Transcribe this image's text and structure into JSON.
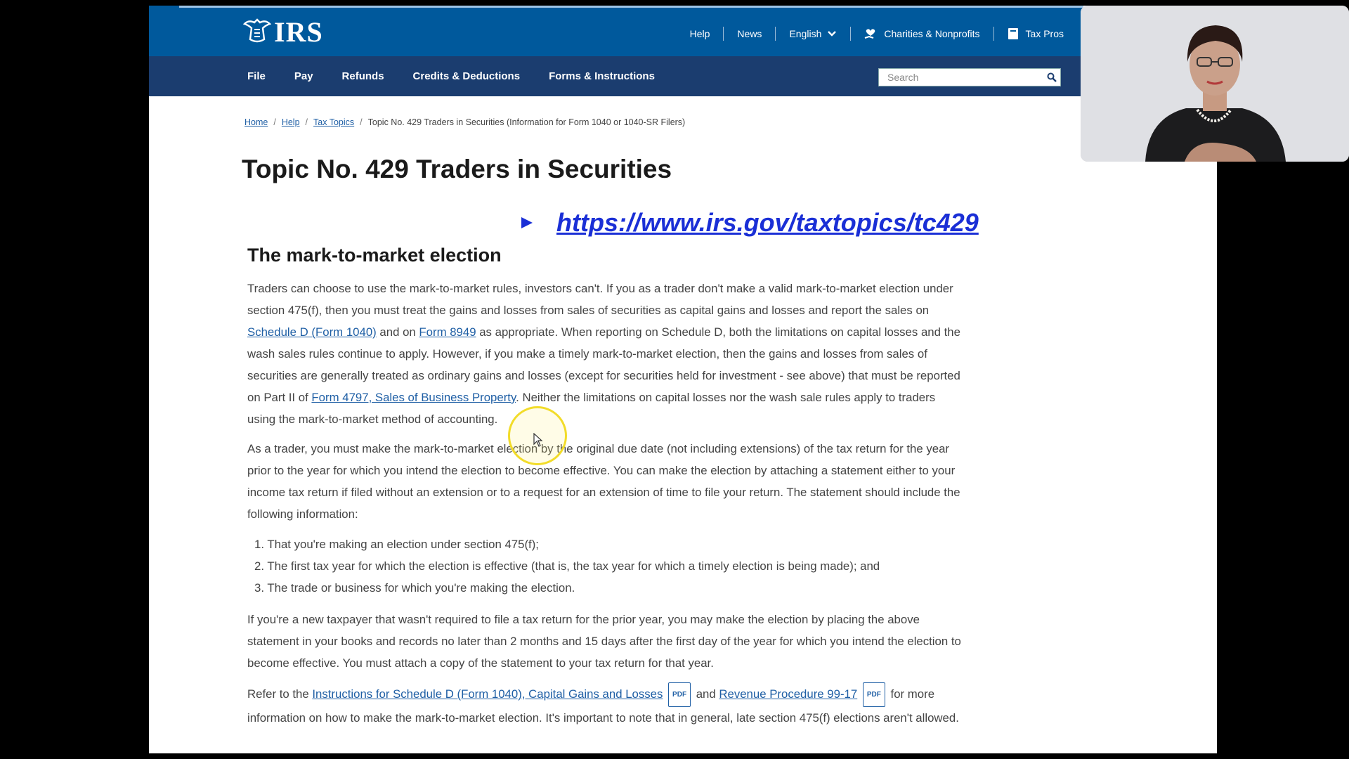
{
  "header": {
    "logo_text": "IRS",
    "top_links": [
      {
        "label": "Help"
      },
      {
        "label": "News"
      },
      {
        "label": "English"
      },
      {
        "label": "Charities & Nonprofits"
      },
      {
        "label": "Tax Pros"
      }
    ]
  },
  "nav": {
    "items": [
      "File",
      "Pay",
      "Refunds",
      "Credits & Deductions",
      "Forms & Instructions"
    ],
    "search_placeholder": "Search"
  },
  "breadcrumb": {
    "items": [
      "Home",
      "Help",
      "Tax Topics"
    ],
    "current": "Topic No. 429 Traders in Securities (Information for Form 1040 or 1040-SR Filers)"
  },
  "page": {
    "title": "Topic No. 429 Traders in Securities",
    "url": "https://www.irs.gov/taxtopics/tc429",
    "section_heading": "The mark-to-market election",
    "p1": {
      "a": "Traders can choose to use the mark-to-market rules, investors can't. If you as a trader don't make a valid mark-to-market election under section 475(f), then you must treat the gains and losses from sales of securities as capital gains and losses and report the sales on ",
      "link1": "Schedule D (Form 1040)",
      "b": " and on ",
      "link2": "Form 8949",
      "c": " as appropriate. When reporting on Schedule D, both the limitations on capital losses and the wash sales rules continue to apply. However, if you make a timely mark-to-market election, then the gains and losses from sales of securities are generally treated as ordinary gains and losses (except for securities held for investment - see above) that must be reported on Part II of ",
      "link3": "Form 4797, Sales of Business Property",
      "d": ". Neither the limitations on capital losses nor the wash sale rules apply to traders using the mark-to-market method of accounting."
    },
    "p2": "As a trader, you must make the mark-to-market election by the original due date (not including extensions) of the tax return for the year prior to the year for which you intend the election to become effective. You can make the election by attaching a statement either to your income tax return if filed without an extension or to a request for an extension of time to file your return. The statement should include the following information:",
    "steps": [
      "1. That you're making an election under section 475(f);",
      "2. The first tax year for which the election is effective (that is, the tax year for which a timely election is being made); and",
      "3. The trade or business for which you're making the election."
    ],
    "p3": "If you're a new taxpayer that wasn't required to file a tax return for the prior year, you may make the election by placing the above statement in your books and records no later than 2 months and 15 days after the first day of the year for which you intend the election to become effective. You must attach a copy of the statement to your tax return for that year.",
    "p4": {
      "a": "Refer to the ",
      "link1": "Instructions for Schedule D (Form 1040), Capital Gains and Losses",
      "pdf1": "PDF",
      "b": " and ",
      "link2": "Revenue Procedure 99-17",
      "pdf2": "PDF",
      "c": " for more information on how to make the mark-to-market election. It's important to note that in general, late section 475(f) elections aren't allowed."
    }
  },
  "colors": {
    "header_blue": "#00599c",
    "nav_navy": "#1b3d6f",
    "link_blue": "#1f5fa5",
    "url_blue": "#1a2fd6",
    "cursor_ring": "#f2dc2a"
  }
}
